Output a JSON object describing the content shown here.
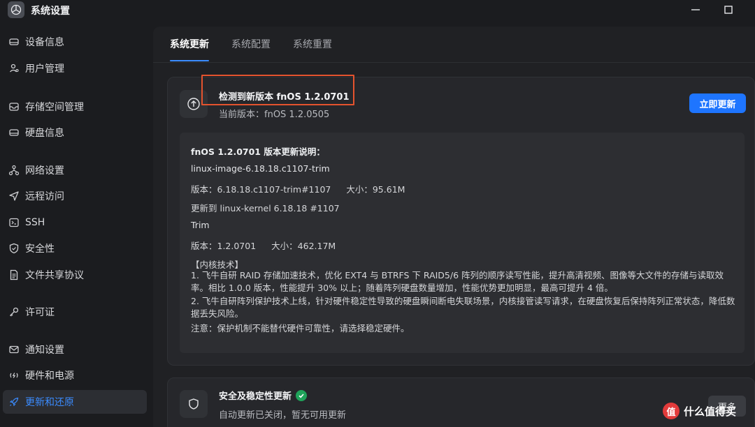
{
  "app": {
    "title": "系统设置",
    "minimize_icon": "minimize-icon",
    "maximize_icon": "maximize-icon"
  },
  "sidebar": {
    "items": [
      {
        "label": "设备信息",
        "icon": "device-icon"
      },
      {
        "label": "用户管理",
        "icon": "users-icon"
      },
      {
        "label": "存储空间管理",
        "icon": "storage-icon"
      },
      {
        "label": "硬盘信息",
        "icon": "disk-icon"
      },
      {
        "label": "网络设置",
        "icon": "network-icon"
      },
      {
        "label": "远程访问",
        "icon": "send-icon"
      },
      {
        "label": "SSH",
        "icon": "terminal-icon"
      },
      {
        "label": "安全性",
        "icon": "shield-icon"
      },
      {
        "label": "文件共享协议",
        "icon": "file-icon"
      },
      {
        "label": "许可证",
        "icon": "key-icon"
      },
      {
        "label": "通知设置",
        "icon": "mail-icon"
      },
      {
        "label": "硬件和电源",
        "icon": "power-icon"
      },
      {
        "label": "更新和还原",
        "icon": "rocket-icon",
        "active": true
      }
    ]
  },
  "tabs": [
    {
      "label": "系统更新",
      "active": true
    },
    {
      "label": "系统配置"
    },
    {
      "label": "系统重置"
    }
  ],
  "update": {
    "title": "检测到新版本 fnOS 1.2.0701",
    "current_version": "当前版本：fnOS 1.2.0505",
    "button": "立即更新",
    "icon": "arrow-up-circle-icon"
  },
  "notes": {
    "heading": "fnOS 1.2.0701 版本更新说明：",
    "pkg1_name": "linux-image-6.18.18.c1107-trim",
    "pkg1_version": "版本：6.18.18.c1107-trim#1107",
    "pkg1_size": "大小：95.61M",
    "pkg1_update": "更新到 linux-kernel 6.18.18 #1107",
    "pkg2_name": "Trim",
    "pkg2_version": "版本：1.2.0701",
    "pkg2_size": "大小：462.17M",
    "kernel_heading": "【内核技术】",
    "kernel_p1": "1. 飞牛自研 RAID 存储加速技术，优化 EXT4 与 BTRFS 下 RAID5/6 阵列的顺序读写性能，提升高清视频、图像等大文件的存储与读取效率。相比 1.0.0 版本，性能提升 30% 以上；随着阵列硬盘数量增加，性能优势更加明显，最高可提升 4 倍。",
    "kernel_p2": "2. 飞牛自研阵列保护技术上线，针对硬件稳定性导致的硬盘瞬间断电失联场景，内核接管读写请求，在硬盘恢复后保持阵列正常状态，降低数据丢失风险。",
    "note": "注意：保护机制不能替代硬件可靠性，请选择稳定硬件。"
  },
  "security": {
    "title": "安全及稳定性更新",
    "subtitle": "自动更新已关闭，暂无可用更新",
    "more_button": "更多",
    "icon": "shield-icon",
    "status_icon": "check-circle-icon"
  },
  "watermark": {
    "text": "什么值得买",
    "logo_glyph": "值"
  },
  "colors": {
    "accent": "#1e75ff",
    "highlight": "#e4532e",
    "success": "#1fa35a"
  }
}
